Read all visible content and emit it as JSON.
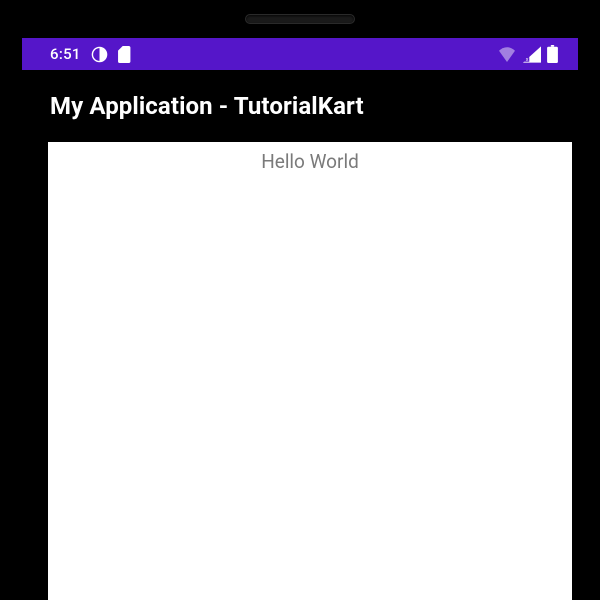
{
  "statusBar": {
    "time": "6:51",
    "accentColor": "#5516C9"
  },
  "appBar": {
    "title": "My Application - TutorialKart"
  },
  "content": {
    "helloText": "Hello World"
  }
}
